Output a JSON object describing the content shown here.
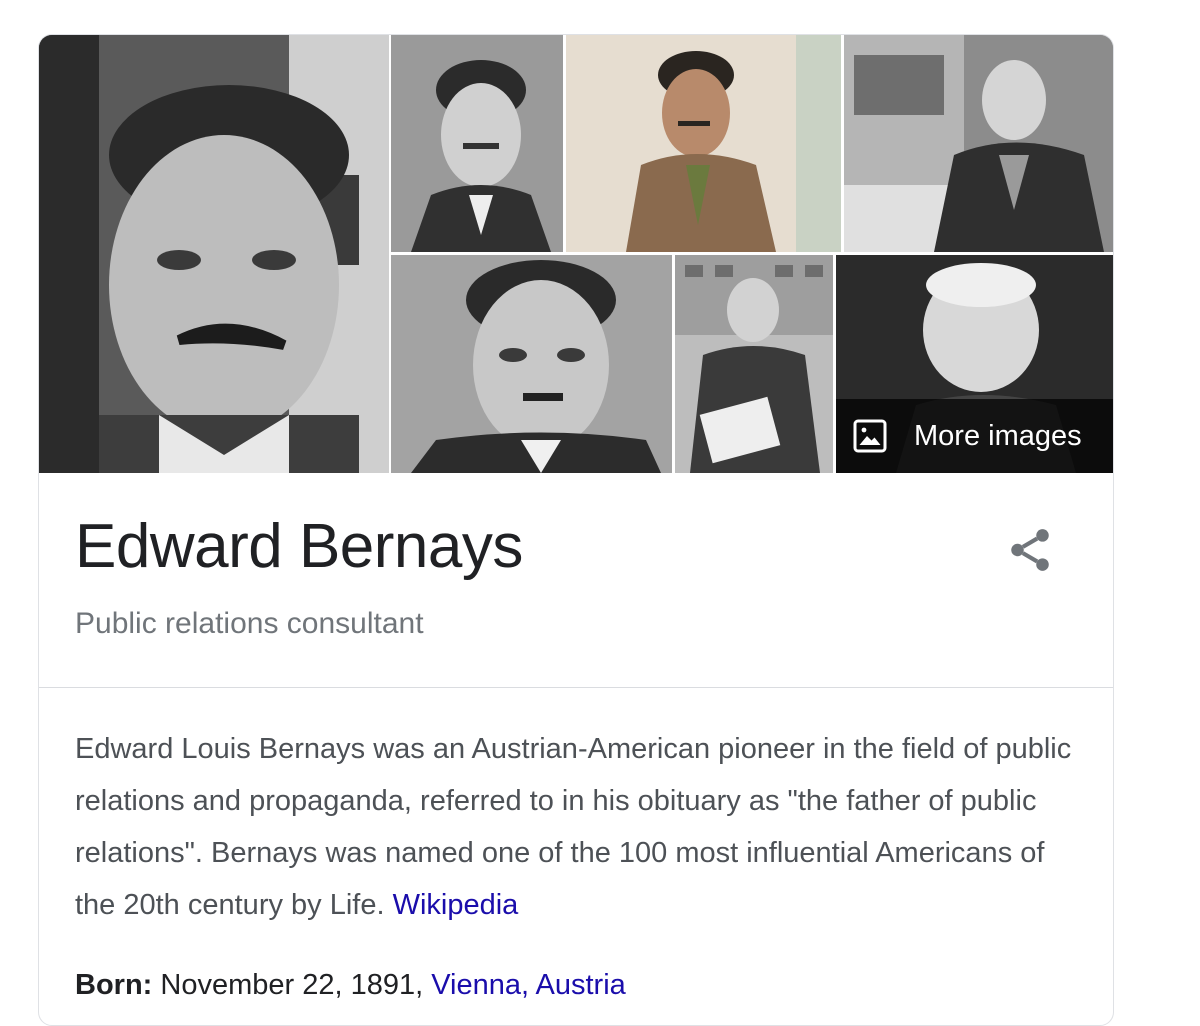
{
  "gallery": {
    "more_images_label": "More images",
    "photos": [
      {
        "name": "photo-main",
        "alt": "Edward Bernays portrait"
      },
      {
        "name": "photo-2",
        "alt": "Edward Bernays in suit"
      },
      {
        "name": "photo-3",
        "alt": "Edward Bernays in brown suit"
      },
      {
        "name": "photo-4",
        "alt": "Elderly Edward Bernays at desk"
      },
      {
        "name": "photo-5",
        "alt": "Edward Bernays close-up"
      },
      {
        "name": "photo-6",
        "alt": "Edward Bernays with newspaper"
      },
      {
        "name": "photo-7",
        "alt": "Elderly Edward Bernays"
      }
    ]
  },
  "entity": {
    "title": "Edward Bernays",
    "subtitle": "Public relations consultant"
  },
  "description": {
    "text": "Edward Louis Bernays was an Austrian-American pioneer in the field of public relations and propaganda, referred to in his obituary as \"the father of public relations\". Bernays was named one of the 100 most influential Americans of the 20th century by Life.",
    "source_link": "Wikipedia"
  },
  "facts": {
    "born_label": "Born:",
    "born_date": "November 22, 1891,",
    "born_place_link": "Vienna, Austria"
  },
  "icons": {
    "share": "share-icon",
    "image": "image-icon"
  }
}
